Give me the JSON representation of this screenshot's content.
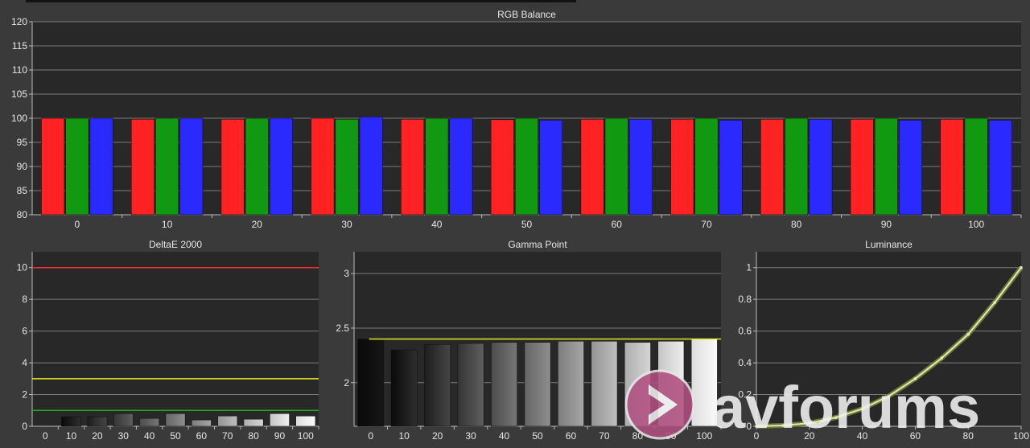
{
  "chart_data": [
    {
      "type": "bar",
      "title": "RGB Balance",
      "categories": [
        "0",
        "10",
        "20",
        "30",
        "40",
        "50",
        "60",
        "70",
        "80",
        "90",
        "100"
      ],
      "series": [
        {
          "color": "#ff2222",
          "values": [
            100.0,
            99.8,
            99.8,
            100.0,
            99.8,
            99.7,
            99.8,
            99.8,
            99.8,
            99.8,
            99.8
          ]
        },
        {
          "color": "#119911",
          "values": [
            100.0,
            100.0,
            100.0,
            99.8,
            100.0,
            100.0,
            100.0,
            100.0,
            100.0,
            100.0,
            100.0
          ]
        },
        {
          "color": "#2a2aff",
          "values": [
            100.0,
            100.0,
            100.0,
            100.3,
            100.0,
            99.6,
            99.8,
            99.6,
            99.8,
            99.6,
            99.6
          ]
        }
      ],
      "ylim": [
        80,
        120
      ],
      "yticks": [
        80,
        85,
        90,
        95,
        100,
        105,
        110,
        115,
        120
      ],
      "grid": true
    },
    {
      "type": "bar",
      "title": "DeltaE 2000",
      "categories": [
        "0",
        "10",
        "20",
        "30",
        "40",
        "50",
        "60",
        "70",
        "80",
        "90",
        "100"
      ],
      "values": [
        0.0,
        0.6,
        0.6,
        0.8,
        0.5,
        0.8,
        0.4,
        0.65,
        0.45,
        0.8,
        0.65
      ],
      "ylim": [
        0,
        11
      ],
      "yticks": [
        0,
        2,
        4,
        6,
        8,
        10
      ],
      "reference_lines": [
        {
          "value": 10,
          "color": "#ff3030"
        },
        {
          "value": 3,
          "color": "#e8e820"
        },
        {
          "value": 1,
          "color": "#22aa22"
        }
      ],
      "grid": true
    },
    {
      "type": "bar",
      "title": "Gamma Point",
      "categories": [
        "0",
        "10",
        "20",
        "30",
        "40",
        "50",
        "60",
        "70",
        "80",
        "90",
        "100"
      ],
      "values": [
        2.4,
        2.3,
        2.35,
        2.36,
        2.37,
        2.37,
        2.38,
        2.38,
        2.37,
        2.38,
        2.4
      ],
      "ylim": [
        1.6,
        3.2
      ],
      "yticks": [
        2,
        2.5,
        3
      ],
      "reference_lines": [
        {
          "value": 2.4,
          "color": "#e8e820"
        }
      ],
      "grid": true
    },
    {
      "type": "line",
      "title": "Luminance",
      "x": [
        0,
        10,
        20,
        30,
        40,
        50,
        60,
        70,
        80,
        90,
        100
      ],
      "series": [
        {
          "color": "#e8e8b0",
          "values": [
            0,
            0.005,
            0.02,
            0.055,
            0.11,
            0.19,
            0.3,
            0.43,
            0.58,
            0.78,
            1.0
          ]
        }
      ],
      "xlim": [
        0,
        100
      ],
      "ylim": [
        0,
        1.1
      ],
      "xticks": [
        0,
        20,
        40,
        60,
        80,
        100
      ],
      "yticks": [
        0,
        0.2,
        0.4,
        0.6,
        0.8,
        1
      ],
      "grid": true
    }
  ],
  "watermark": {
    "text": "avforums"
  }
}
